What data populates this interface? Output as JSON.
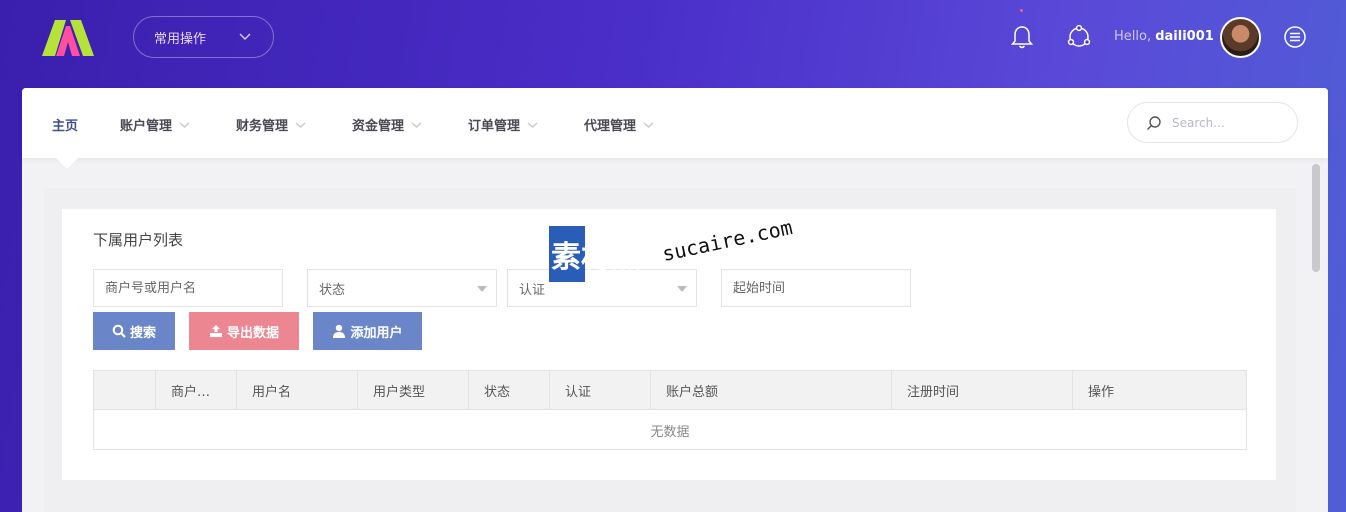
{
  "topbar": {
    "quick_ops_label": "常用操作",
    "greeting_prefix": "Hello, ",
    "username": "daili001",
    "logo_colors": {
      "left": "#b6e23a",
      "right": "#ff4fa0"
    }
  },
  "nav": {
    "items": [
      {
        "label": "主页",
        "active": true,
        "dropdown": false
      },
      {
        "label": "账户管理",
        "active": false,
        "dropdown": true
      },
      {
        "label": "财务管理",
        "active": false,
        "dropdown": true
      },
      {
        "label": "资金管理",
        "active": false,
        "dropdown": true
      },
      {
        "label": "订单管理",
        "active": false,
        "dropdown": true
      },
      {
        "label": "代理管理",
        "active": false,
        "dropdown": true
      }
    ],
    "search_placeholder": "Search..."
  },
  "card": {
    "title": "下属用户列表",
    "filters": {
      "merchant_placeholder": "商户号或用户名",
      "status_value": "状态",
      "auth_value": "认证",
      "start_time_placeholder": "起始时间"
    },
    "buttons": {
      "search": "搜索",
      "export": "导出数据",
      "add_user": "添加用户"
    },
    "table": {
      "headers": [
        "",
        "商户…",
        "用户名",
        "用户类型",
        "状态",
        "认证",
        "账户总额",
        "注册时间",
        "操作"
      ],
      "empty_text": "无数据"
    }
  },
  "watermark": {
    "cjk": "素材熱",
    "latin": "sucaire.com"
  },
  "colors": {
    "accent_blue": "#6a86c9",
    "accent_pink": "#ec8690",
    "nav_active": "#3f4e93"
  }
}
